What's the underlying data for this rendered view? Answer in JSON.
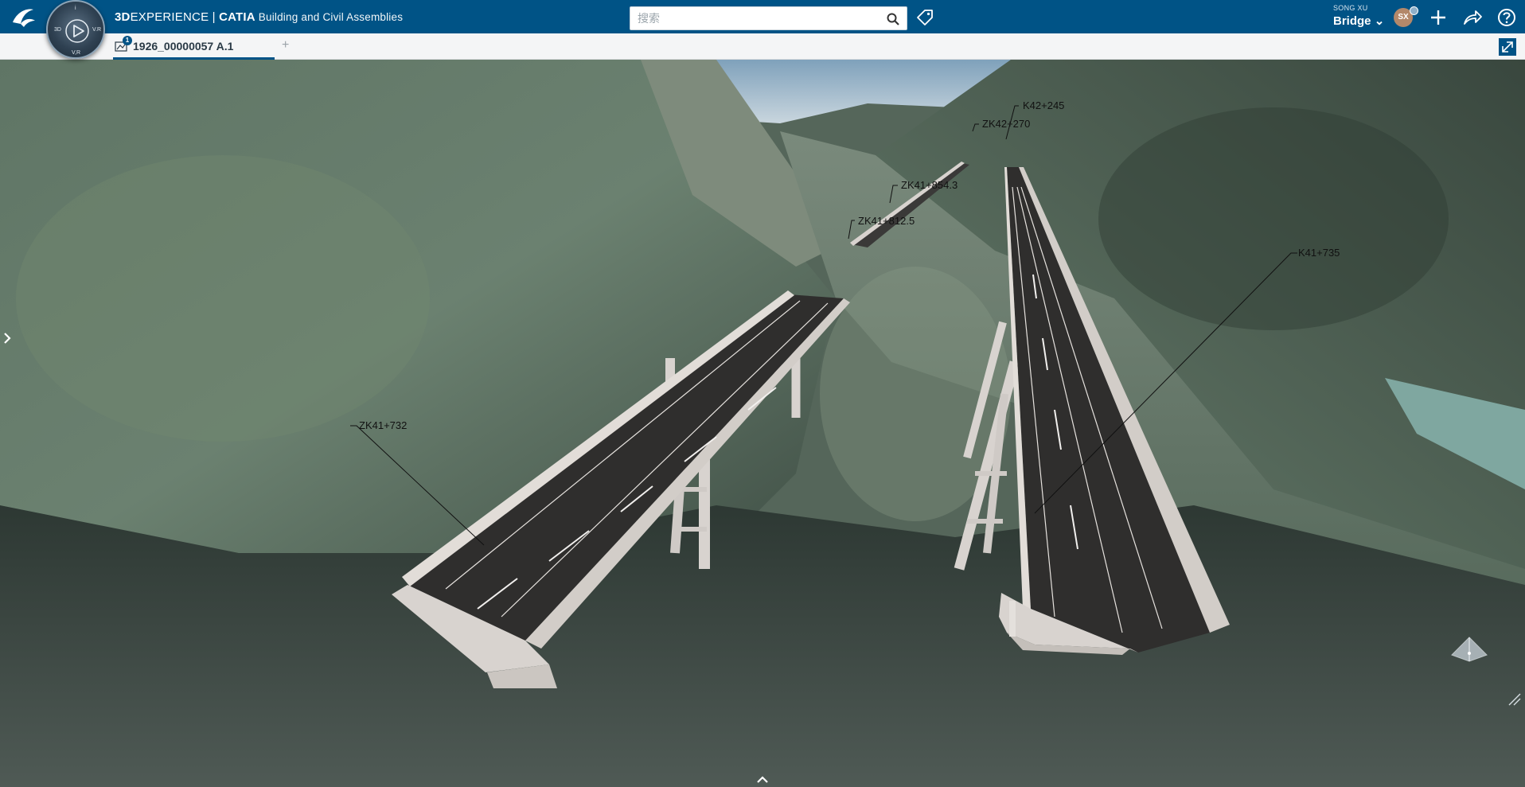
{
  "app": {
    "brand_bold": "3D",
    "brand_thin": "EXPERIENCE | ",
    "brand_app": "CATIA",
    "brand_sub": " Building and Civil Assemblies"
  },
  "compass": {
    "left": "3D",
    "right": "V.R",
    "top": "i",
    "bottom": "V,R"
  },
  "search": {
    "placeholder": "搜索",
    "value": ""
  },
  "user": {
    "name": "SONG XU",
    "space": "Bridge",
    "initials": "SX"
  },
  "tabs": [
    {
      "title": "1926_00000057 A.1",
      "badge": "1"
    }
  ],
  "tab_add_label": "+",
  "stations": {
    "k42_245": "K42+245",
    "zk42_270": "ZK42+270",
    "zk41_854": "ZK41+854.3",
    "zk41_812": "ZK41+812.5",
    "k41_735": "K41+735",
    "zk41_732": "ZK41+732"
  },
  "colors": {
    "header": "#005386",
    "tab_accent": "#005386",
    "road": "#2f2e2d",
    "concrete": "#d8d3cf"
  },
  "icons": {
    "logo": "ds-logo-icon",
    "search": "search-icon",
    "tag": "tag-icon",
    "add": "plus-icon",
    "share": "share-icon",
    "help": "help-icon",
    "expand": "expand-icon",
    "nav": "navigation-cube-icon"
  }
}
